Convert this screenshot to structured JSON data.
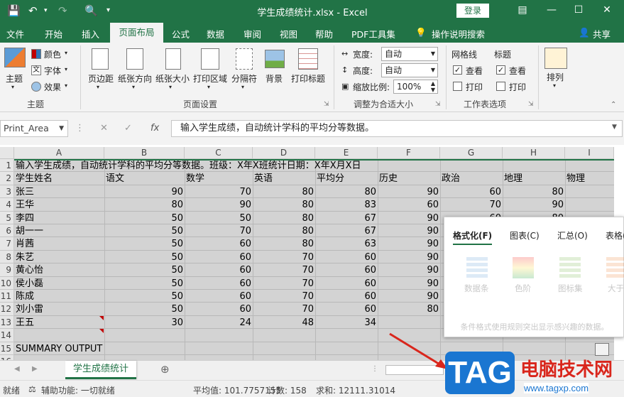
{
  "titlebar": {
    "doc_title": "学生成绩统计.xlsx  -  Excel",
    "login": "登录"
  },
  "ribbon_tabs": [
    "文件",
    "开始",
    "插入",
    "页面布局",
    "公式",
    "数据",
    "审阅",
    "视图",
    "帮助",
    "PDF工具集",
    "操作说明搜索",
    "共享"
  ],
  "theme_group": {
    "themes": "主题",
    "colors": "颜色",
    "fonts": "字体",
    "effects": "效果",
    "group": "主题"
  },
  "page_setup": {
    "margins": "页边距",
    "orientation": "纸张方向",
    "size": "纸张大小",
    "print_area": "打印区域",
    "breaks": "分隔符",
    "background": "背景",
    "print_titles": "打印标题",
    "group": "页面设置"
  },
  "scale": {
    "width_label": "宽度:",
    "width_value": "自动",
    "height_label": "高度:",
    "height_value": "自动",
    "scale_label": "缩放比例:",
    "scale_value": "100%",
    "group": "调整为合适大小"
  },
  "sheet_options": {
    "gridlines": "网格线",
    "headings": "标题",
    "view1": "查看",
    "print1": "打印",
    "view2": "查看",
    "print2": "打印",
    "group": "工作表选项"
  },
  "arrange": {
    "label": "排列"
  },
  "formula_bar": {
    "name_box": "Print_Area",
    "fx": "fx",
    "formula": "输入学生成绩，自动统计学科的平均分等数据。"
  },
  "columns": [
    "A",
    "B",
    "C",
    "D",
    "E",
    "F",
    "G",
    "H",
    "I"
  ],
  "rows": [
    "1",
    "2",
    "3",
    "4",
    "5",
    "6",
    "7",
    "8",
    "9",
    "10",
    "11",
    "12",
    "13",
    "14",
    "15",
    "16"
  ],
  "title_row": "输入学生成绩，自动统计学科的平均分等数据。班级：X年X班统计日期：X年X月X日",
  "headers": [
    "学生姓名",
    "语文",
    "数学",
    "英语",
    "平均分",
    "历史",
    "政治",
    "地理",
    "物理"
  ],
  "students": [
    {
      "name": "张三",
      "v": [
        "90",
        "70",
        "80",
        "80",
        "90",
        "60",
        "80"
      ]
    },
    {
      "name": "王华",
      "v": [
        "80",
        "90",
        "80",
        "83",
        "60",
        "70",
        "90"
      ]
    },
    {
      "name": "李四",
      "v": [
        "50",
        "50",
        "80",
        "67",
        "90",
        "60",
        "80"
      ]
    },
    {
      "name": "胡一一",
      "v": [
        "50",
        "70",
        "80",
        "67",
        "90",
        "",
        ""
      ]
    },
    {
      "name": "肖茜",
      "v": [
        "50",
        "60",
        "80",
        "63",
        "90",
        "",
        ""
      ]
    },
    {
      "name": "朱艺",
      "v": [
        "50",
        "60",
        "70",
        "60",
        "90",
        "",
        ""
      ]
    },
    {
      "name": "黄心怡",
      "v": [
        "50",
        "60",
        "70",
        "60",
        "90",
        "",
        ""
      ]
    },
    {
      "name": "侯小磊",
      "v": [
        "50",
        "60",
        "70",
        "60",
        "90",
        "",
        ""
      ]
    },
    {
      "name": "陈成",
      "v": [
        "50",
        "60",
        "70",
        "60",
        "90",
        "",
        ""
      ]
    },
    {
      "name": "刘小雷",
      "v": [
        "50",
        "60",
        "70",
        "60",
        "80",
        "",
        ""
      ]
    },
    {
      "name": "王五",
      "v": [
        "30",
        "24",
        "48",
        "34",
        "",
        "",
        ""
      ]
    }
  ],
  "summary": "SUMMARY OUTPUT",
  "popup": {
    "tabs": [
      "格式化(F)",
      "图表(C)",
      "汇总(O)",
      "表格("
    ],
    "items": [
      "数据条",
      "色阶",
      "图标集",
      "大于"
    ],
    "desc": "条件格式使用规则突出显示感兴趣的数据。"
  },
  "sheet_tab": "学生成绩统计",
  "status": {
    "ready": "就绪",
    "accessibility": "辅助功能: 一切就绪",
    "average": "平均值: 101.7757155",
    "count": "计数: 158",
    "sum": "求和: 12111.31014"
  },
  "watermark": {
    "tag": "TAG",
    "name": "电脑技术网",
    "url": "www.tagxp.com"
  },
  "colors": {
    "excel_green": "#217346",
    "selection_gray": "#d3d3d3"
  }
}
